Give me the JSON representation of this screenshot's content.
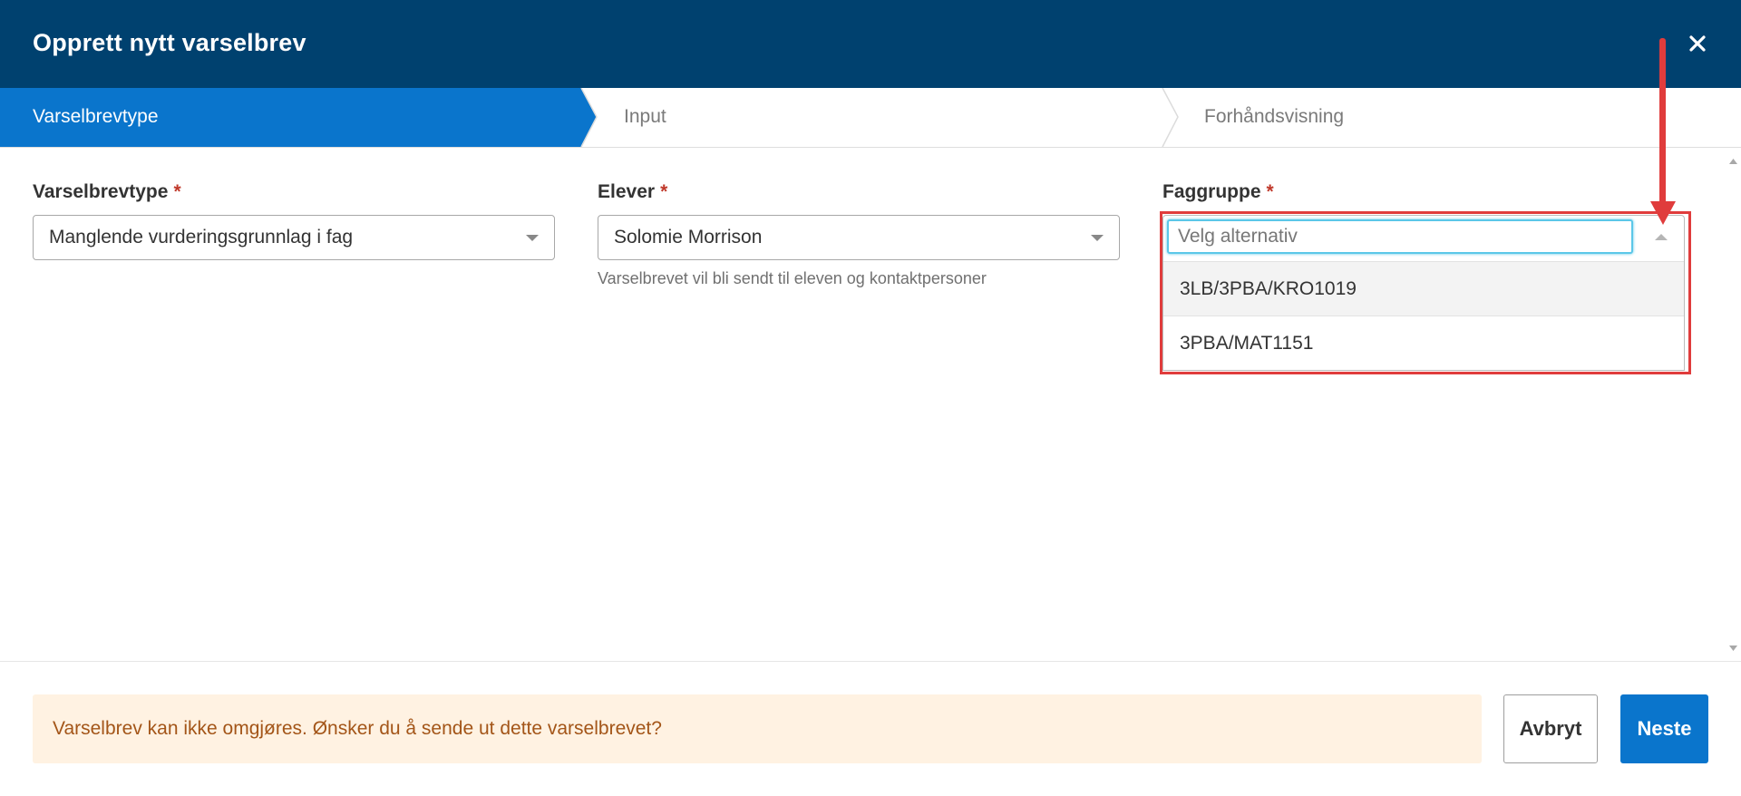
{
  "dialog": {
    "title": "Opprett nytt varselbrev"
  },
  "steps": [
    {
      "label": "Varselbrevtype",
      "active": true
    },
    {
      "label": "Input",
      "active": false
    },
    {
      "label": "Forhåndsvisning",
      "active": false
    }
  ],
  "form": {
    "required_marker": "*",
    "varselbrevtype": {
      "label": "Varselbrevtype",
      "value": "Manglende vurderingsgrunnlag i fag"
    },
    "elever": {
      "label": "Elever",
      "value": "Solomie Morrison",
      "help": "Varselbrevet vil bli sendt til eleven og kontaktpersoner"
    },
    "faggruppe": {
      "label": "Faggruppe",
      "placeholder": "Velg alternativ",
      "options": [
        "3LB/3PBA/KRO1019",
        "3PBA/MAT1151"
      ]
    }
  },
  "footer": {
    "warning": "Varselbrev kan ikke omgjøres. Ønsker du å sende ut dette varselbrevet?",
    "cancel_label": "Avbryt",
    "next_label": "Neste"
  },
  "colors": {
    "header_bg": "#00416f",
    "active_step": "#0a75cc",
    "annotation": "#e03c3c",
    "warning_bg": "#fff2e2",
    "warning_text": "#a35518"
  },
  "icons": {
    "close": "close-icon",
    "dropdown": "chevron-down-icon"
  }
}
